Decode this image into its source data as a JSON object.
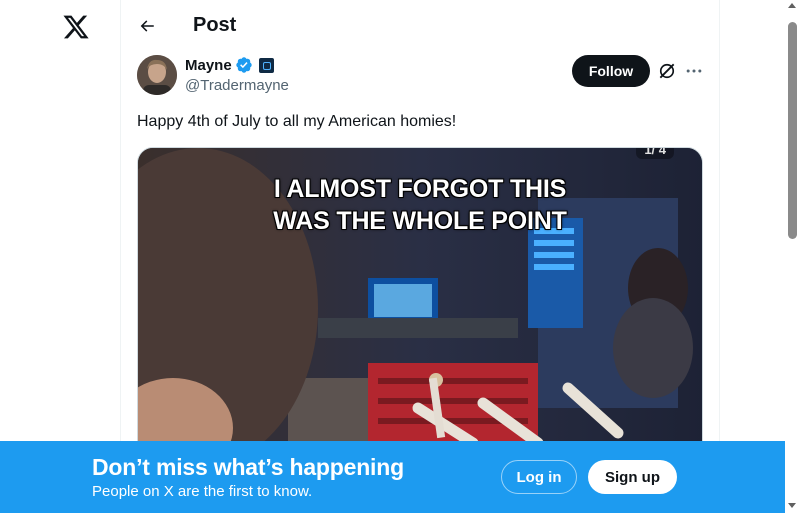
{
  "header": {
    "logo_icon": "x-logo-icon",
    "back_icon": "arrow-left-icon",
    "title": "Post"
  },
  "post": {
    "author": {
      "name": "Mayne",
      "handle": "@Tradermayne",
      "verified_icon": "verified-badge-icon",
      "verified_color": "#1d9bf0",
      "affiliation_icon": "affiliate-badge-icon"
    },
    "follow_label": "Follow",
    "grok_icon": "grok-icon",
    "more_icon": "more-dots-icon",
    "text": "Happy 4th of July to all my American homies!",
    "media": {
      "caption_line1": "I ALMOST FORGOT THIS",
      "caption_line2": "WAS THE WHOLE POINT",
      "counter": "1/ 4"
    }
  },
  "banner": {
    "title": "Don’t miss what’s happening",
    "subtitle": "People on X are the first to know.",
    "login_label": "Log in",
    "signup_label": "Sign up",
    "color": "#1d9bf0"
  }
}
